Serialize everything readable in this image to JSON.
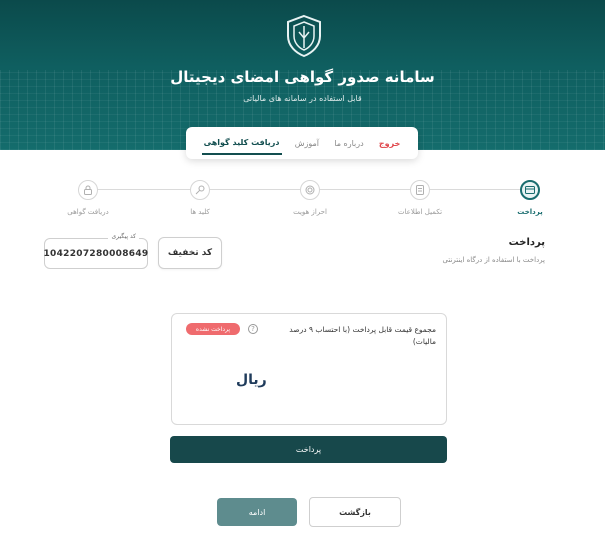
{
  "header": {
    "title": "سامانه صدور گواهی امضای دیجیتال",
    "subtitle": "قابل استفاده در سامانه های مالیاتی",
    "colors": {
      "background": "#0f5f60",
      "accent": "#124e4f"
    }
  },
  "nav": {
    "tabs": [
      {
        "label": "دریافت کلید گواهی",
        "active": true
      },
      {
        "label": "آموزش",
        "active": false
      },
      {
        "label": "درباره ما",
        "active": false
      },
      {
        "label": "خروج",
        "active": false
      }
    ]
  },
  "stepper": {
    "steps": [
      {
        "label": "پرداخت",
        "icon": "card-icon",
        "active": true
      },
      {
        "label": "تکمیل اطلاعات",
        "icon": "document-icon",
        "active": false
      },
      {
        "label": "احراز هویت",
        "icon": "fingerprint-icon",
        "active": false
      },
      {
        "label": "کلید ها",
        "icon": "key-icon",
        "active": false
      },
      {
        "label": "دریافت گواهی",
        "icon": "lock-icon",
        "active": false
      }
    ]
  },
  "payment": {
    "title": "پرداخت",
    "description": "پرداخت با استفاده از درگاه اینترنتی",
    "discount_label": "کد تخفیف",
    "tracking_label": "کد پیگیری",
    "tracking_code": "1042207280008649",
    "price_text": "مجموع قیمت قابل پرداخت (با احتساب ۹ درصد مالیات)",
    "badge": "پرداخت نشده",
    "price_value": "ریال",
    "pay_button": "پرداخت"
  },
  "footer": {
    "continue_button": "ادامه",
    "back_button": "بازگشت"
  }
}
